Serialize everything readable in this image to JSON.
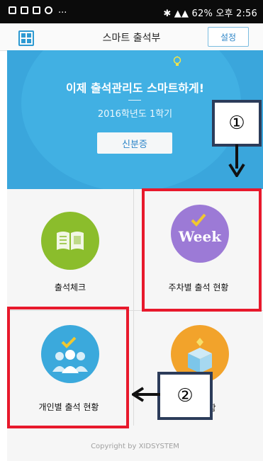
{
  "statusbar": {
    "left_dots": "...",
    "right_text": "62%  오후 2:56"
  },
  "appbar": {
    "title": "스마트 출석부",
    "settings_label": "설정",
    "menu_icon": "grid-icon"
  },
  "banner": {
    "headline": "이제 출석관리도 스마트하게!",
    "term": "2016학년도 1학기",
    "idcard_label": "신분증",
    "icon": "lightbulb-icon",
    "colors": {
      "bg": "#3aa6dc",
      "circle": "#41b0e3"
    }
  },
  "menu": {
    "items": [
      {
        "label": "출석체크",
        "icon": "book-icon",
        "color": "#8bbd2c"
      },
      {
        "label": "주차별 출석 현황",
        "icon": "week-icon",
        "color": "#9c7ad6"
      },
      {
        "label": "개인별 출석 현황",
        "icon": "people-icon",
        "color": "#3ba9dc"
      },
      {
        "label": "함",
        "icon": "box-icon",
        "color": "#f2a32b"
      }
    ]
  },
  "annotations": {
    "marker1": "①",
    "marker2": "②",
    "box_color": "#e8192c",
    "marker_border": "#2c3c5a"
  },
  "footer": {
    "copyright": "Copyright by XIDSYSTEM"
  }
}
